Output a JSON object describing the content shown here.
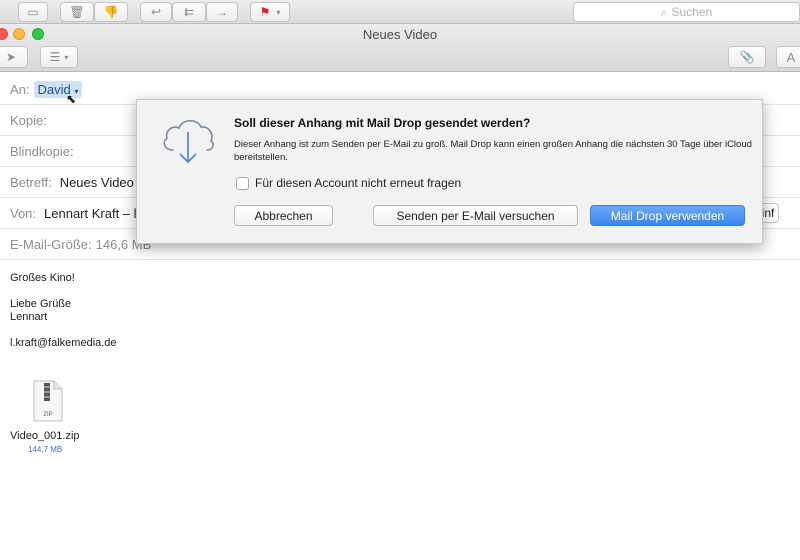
{
  "main_toolbar": {
    "search_placeholder": "Suchen",
    "icons": [
      "archive-icon",
      "trash-icon",
      "junk-icon",
      "reply-icon",
      "reply-all-icon",
      "forward-icon",
      "flag-icon"
    ]
  },
  "window": {
    "title": "Neues Video"
  },
  "compose": {
    "to_label": "An:",
    "to_token": "David",
    "cc_label": "Kopie:",
    "bcc_label": "Blindkopie:",
    "subject_label": "Betreff:",
    "subject_value": "Neues Video",
    "from_label": "Von:",
    "from_value": "Lennart Kraft – l.",
    "signature_partial": "ny einf",
    "size_label": "E-Mail-Größe:",
    "size_value": "146,6 MB",
    "body": {
      "line1": "Großes Kino!",
      "line2": "Liebe Grüße",
      "line3": "Lennart",
      "line4": "l.kraft@falkemedia.de"
    },
    "attachment": {
      "name": "Video_001.zip",
      "size": "144,7 MB",
      "type_label": "ZIP"
    }
  },
  "dialog": {
    "title": "Soll dieser Anhang mit Mail Drop gesendet werden?",
    "message": "Dieser Anhang ist zum Senden per E-Mail zu groß. Mail Drop kann einen großen Anhang die nächsten 30 Tage über iCloud bereitstellen.",
    "checkbox_label": "Für diesen Account nicht erneut fragen",
    "btn_cancel": "Abbrechen",
    "btn_try_email": "Senden per E-Mail versuchen",
    "btn_maildrop": "Mail Drop verwenden",
    "accent_color": "#3d86ef"
  }
}
